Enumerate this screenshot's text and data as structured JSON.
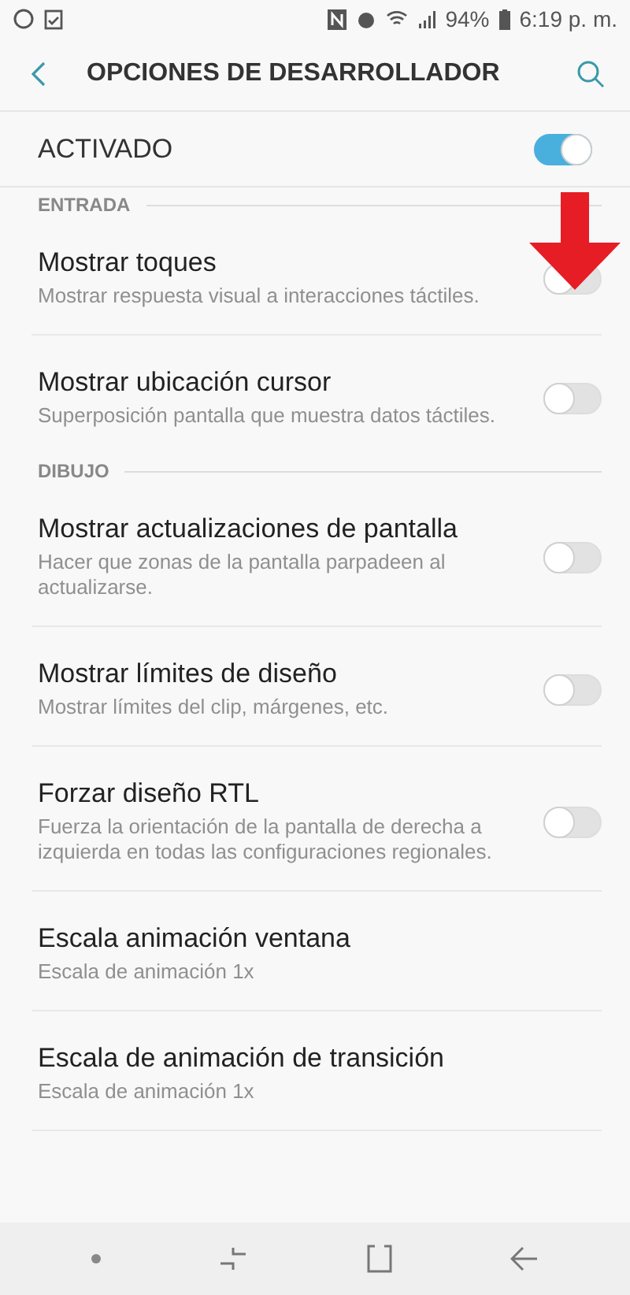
{
  "status_bar": {
    "battery": "94%",
    "time": "6:19 p. m."
  },
  "header": {
    "title": "OPCIONES DE DESARROLLADOR"
  },
  "master": {
    "label": "ACTIVADO",
    "on": true
  },
  "sections": [
    {
      "title": "ENTRADA",
      "items": [
        {
          "kind": "toggle",
          "title": "Mostrar toques",
          "subtitle": "Mostrar respuesta visual a interacciones táctiles.",
          "on": false
        },
        {
          "kind": "toggle",
          "title": "Mostrar ubicación cursor",
          "subtitle": "Superposición pantalla que muestra datos táctiles.",
          "on": false
        }
      ]
    },
    {
      "title": "DIBUJO",
      "items": [
        {
          "kind": "toggle",
          "title": "Mostrar actualizaciones de pantalla",
          "subtitle": "Hacer que zonas de la pantalla parpadeen al actualizarse.",
          "on": false
        },
        {
          "kind": "toggle",
          "title": "Mostrar límites de diseño",
          "subtitle": "Mostrar límites del clip, márgenes, etc.",
          "on": false
        },
        {
          "kind": "toggle",
          "title": "Forzar diseño RTL",
          "subtitle": "Fuerza la orientación de la pantalla de derecha a izquierda en todas las configuraciones regionales.",
          "on": false
        },
        {
          "kind": "value",
          "title": "Escala animación ventana",
          "subtitle": "Escala de animación 1x"
        },
        {
          "kind": "value",
          "title": "Escala de animación de transición",
          "subtitle": "Escala de animación 1x"
        }
      ]
    }
  ]
}
